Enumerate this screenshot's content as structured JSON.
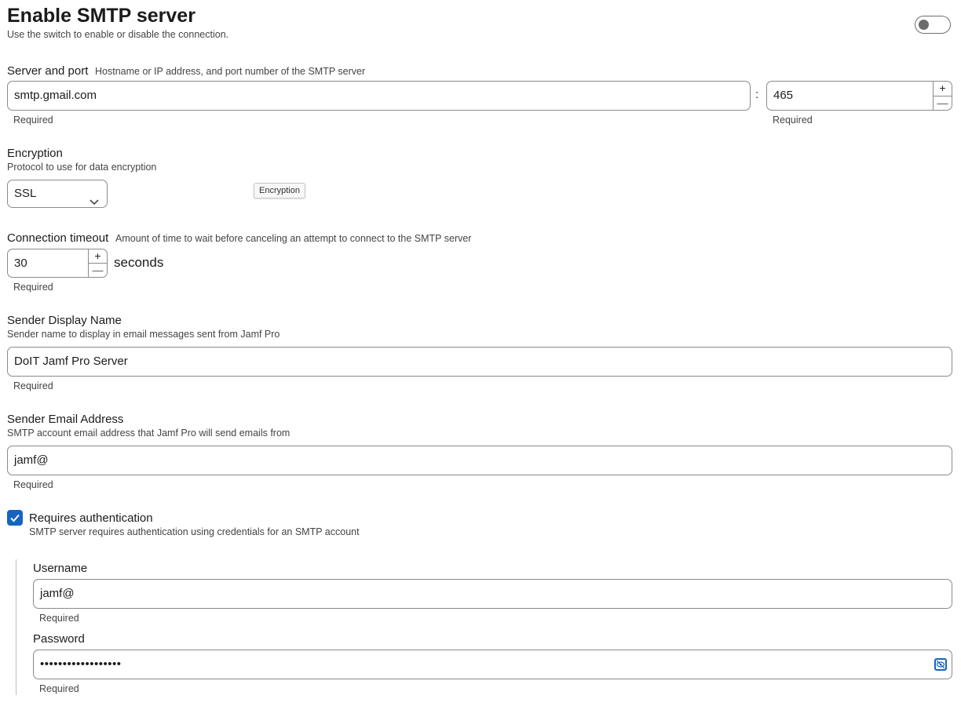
{
  "header": {
    "title": "Enable SMTP server",
    "subtitle": "Use the switch to enable or disable the connection.",
    "toggle_state": "off"
  },
  "server": {
    "label": "Server and port",
    "hint": "Hostname or IP address, and port number of the SMTP server",
    "host_value": "smtp.gmail.com",
    "separator": ":",
    "port_value": "465",
    "host_required": "Required",
    "port_required": "Required"
  },
  "encryption": {
    "label": "Encryption",
    "hint": "Protocol to use for data encryption",
    "selected": "SSL",
    "tooltip": "Encryption"
  },
  "timeout": {
    "label": "Connection timeout",
    "hint": "Amount of time to wait before canceling an attempt to connect to the SMTP server",
    "value": "30",
    "unit": "seconds",
    "required": "Required"
  },
  "sender_name": {
    "label": "Sender Display Name",
    "hint": "Sender name to display in email messages sent from Jamf Pro",
    "value": "DoIT Jamf Pro Server",
    "required": "Required"
  },
  "sender_email": {
    "label": "Sender Email Address",
    "hint": "SMTP account email address that Jamf Pro will send emails from",
    "value": "jamf@",
    "required": "Required"
  },
  "auth": {
    "checkbox_label": "Requires authentication",
    "checked": true,
    "hint": "SMTP server requires authentication using credentials for an SMTP account",
    "username_label": "Username",
    "username_value": "jamf@",
    "username_required": "Required",
    "password_label": "Password",
    "password_value": "••••••••••••••••••",
    "password_required": "Required"
  },
  "stepper": {
    "plus": "+",
    "minus": "—"
  },
  "colors": {
    "accent": "#1565c0",
    "border": "#8a8a8a"
  }
}
